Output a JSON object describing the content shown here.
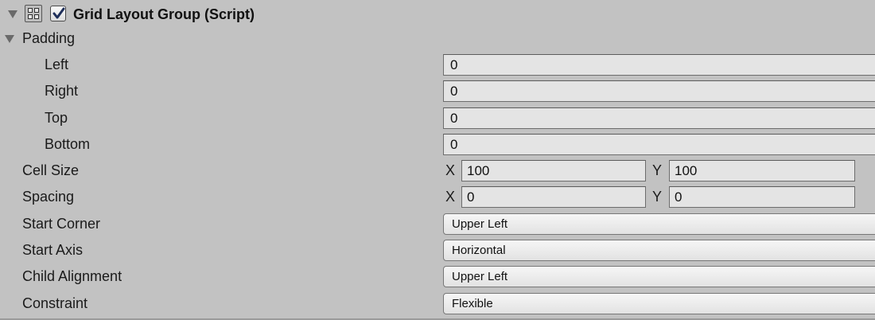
{
  "component": {
    "title": "Grid Layout Group (Script)",
    "enabled": true
  },
  "padding": {
    "label": "Padding",
    "fields": [
      {
        "label": "Left",
        "value": "0"
      },
      {
        "label": "Right",
        "value": "0"
      },
      {
        "label": "Top",
        "value": "0"
      },
      {
        "label": "Bottom",
        "value": "0"
      }
    ]
  },
  "cell_size": {
    "label": "Cell Size",
    "x_label": "X",
    "x_value": "100",
    "y_label": "Y",
    "y_value": "100"
  },
  "spacing": {
    "label": "Spacing",
    "x_label": "X",
    "x_value": "0",
    "y_label": "Y",
    "y_value": "0"
  },
  "start_corner": {
    "label": "Start Corner",
    "value": "Upper Left"
  },
  "start_axis": {
    "label": "Start Axis",
    "value": "Horizontal"
  },
  "child_alignment": {
    "label": "Child Alignment",
    "value": "Upper Left"
  },
  "constraint": {
    "label": "Constraint",
    "value": "Flexible"
  },
  "icons": {
    "foldout": "triangle-down-icon",
    "component": "grid-layout-icon",
    "checkbox": "checkmark-icon"
  }
}
